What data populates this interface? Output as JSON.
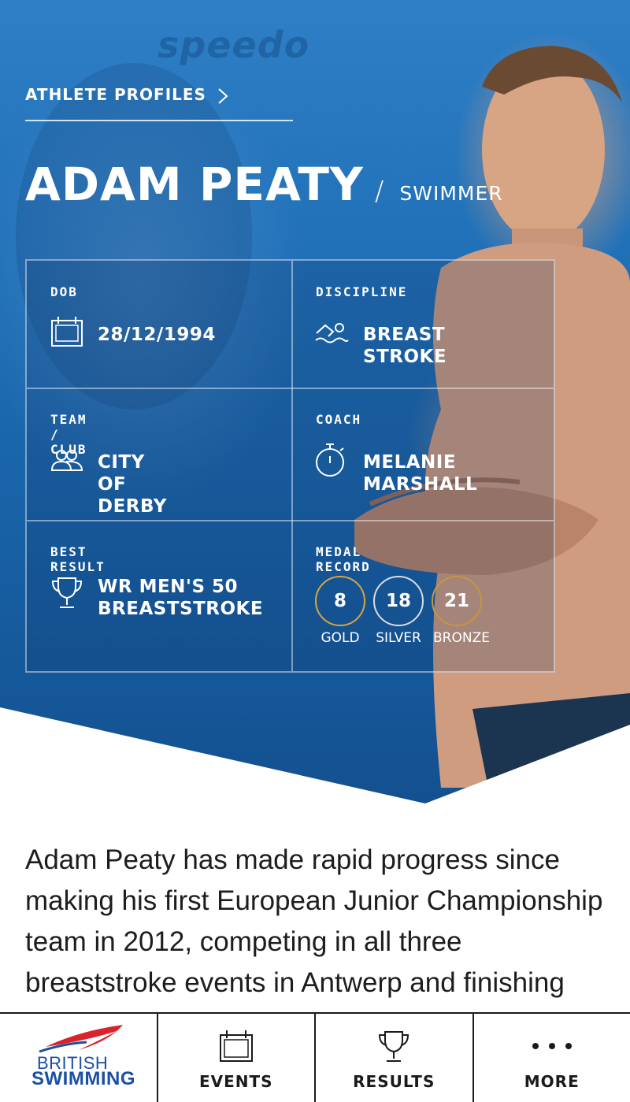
{
  "breadcrumb": {
    "label": "ATHLETE PROFILES"
  },
  "background": {
    "brand_text": "speedo"
  },
  "athlete": {
    "name": "ADAM PEATY",
    "separator": "/",
    "role": "SWIMMER"
  },
  "info": {
    "dob": {
      "label": "DOB",
      "value": "28/12/1994",
      "icon": "calendar-icon"
    },
    "discipline": {
      "label": "DISCIPLINE",
      "value": "BREAST STROKE",
      "icon": "swimmer-icon"
    },
    "team": {
      "label": "TEAM / CLUB",
      "value": "CITY OF DERBY",
      "icon": "people-icon"
    },
    "coach": {
      "label": "COACH",
      "value": "MELANIE\nMARSHALL",
      "icon": "stopwatch-icon"
    },
    "best_result": {
      "label": "BEST RESULT",
      "value": "WR MEN'S 50\nBREASTSTROKE",
      "icon": "trophy-icon"
    },
    "medals": {
      "label": "MEDAL RECORD",
      "gold": {
        "count": "8",
        "caption": "GOLD",
        "color": "#d8a540"
      },
      "silver": {
        "count": "18",
        "caption": "SILVER",
        "color": "#d8dde4"
      },
      "bronze": {
        "count": "21",
        "caption": "BRONZE",
        "color": "#c8963c"
      }
    }
  },
  "bio": "Adam Peaty has made rapid progress since making his first European Junior Championship team in 2012, competing in all three breaststroke events in Antwerp and finishing",
  "tabs": {
    "home": {
      "logo_line1": "BRITISH",
      "logo_line2": "SWIMMING"
    },
    "events": {
      "label": "EVENTS",
      "icon": "calendar-icon"
    },
    "results": {
      "label": "RESULTS",
      "icon": "trophy-icon"
    },
    "more": {
      "label": "MORE",
      "icon": "more-dots-icon"
    }
  },
  "colors": {
    "hero_blue": "#1f6fb6",
    "brand_blue": "#1b4fa3",
    "brand_red": "#d8232a",
    "tab_border": "#1a1a1a"
  }
}
